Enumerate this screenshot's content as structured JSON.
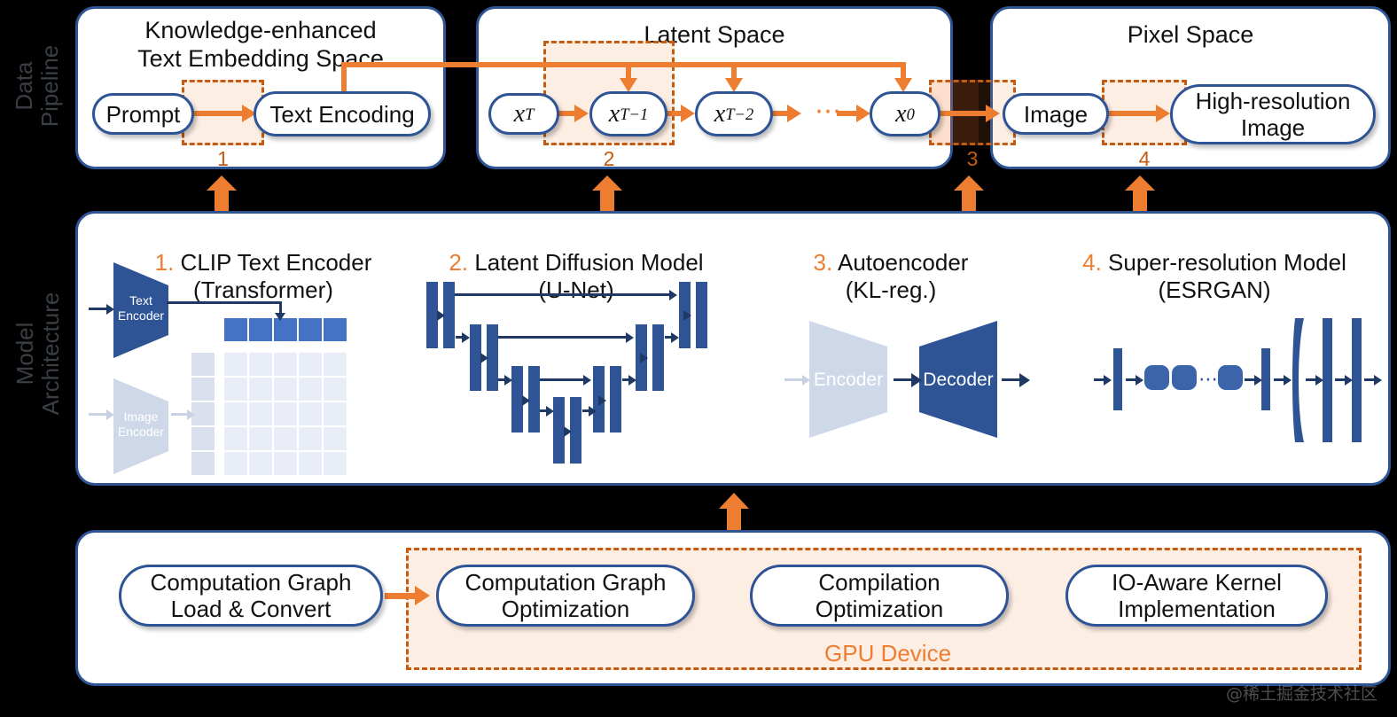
{
  "side_labels": [
    {
      "id": "data-pipeline",
      "text": "Data\nPipeline"
    },
    {
      "id": "model-architecture",
      "text": "Model\nArchitecture"
    }
  ],
  "data_pipeline": {
    "panels": [
      {
        "id": "text-embedding-space",
        "title": "Knowledge-enhanced\nText Embedding Space"
      },
      {
        "id": "latent-space",
        "title": "Latent Space"
      },
      {
        "id": "pixel-space",
        "title": "Pixel Space"
      }
    ],
    "nodes": [
      {
        "id": "prompt",
        "label": "Prompt"
      },
      {
        "id": "text-encoding",
        "label": "Text Encoding"
      },
      {
        "id": "x-T",
        "label": "x",
        "sub": "T"
      },
      {
        "id": "x-T-1",
        "label": "x",
        "sub": "T−1"
      },
      {
        "id": "x-T-2",
        "label": "x",
        "sub": "T−2"
      },
      {
        "id": "x-0",
        "label": "x",
        "sub": "0"
      },
      {
        "id": "image",
        "label": "Image"
      },
      {
        "id": "high-resolution-image",
        "label": "High-resolution\nImage"
      }
    ],
    "ellipsis": "⋯",
    "step_numbers": [
      "1",
      "2",
      "3",
      "4"
    ]
  },
  "model_architecture": {
    "blocks": [
      {
        "num": "1.",
        "title": " CLIP Text Encoder",
        "subtitle": "(Transformer)"
      },
      {
        "num": "2.",
        "title": " Latent Diffusion Model",
        "subtitle": "(U-Net)"
      },
      {
        "num": "3.",
        "title": " Autoencoder",
        "subtitle": "(KL-reg.)"
      },
      {
        "num": "4.",
        "title": " Super-resolution Model",
        "subtitle": "(ESRGAN)"
      }
    ],
    "clip": {
      "text_encoder": "Text\nEncoder",
      "image_encoder": "Image\nEncoder"
    },
    "autoencoder": {
      "encoder": "Encoder",
      "decoder": "Decoder"
    },
    "esrgan": {
      "ellipsis": "⋯"
    }
  },
  "runtime": {
    "nodes": [
      {
        "id": "computation-graph-load-convert",
        "label": "Computation Graph\nLoad & Convert"
      },
      {
        "id": "computation-graph-optimization",
        "label": "Computation Graph\nOptimization"
      },
      {
        "id": "compilation-optimization",
        "label": "Compilation\nOptimization"
      },
      {
        "id": "io-aware-kernel-implementation",
        "label": "IO-Aware Kernel\nImplementation"
      }
    ],
    "gpu_label": "GPU Device"
  },
  "watermark": "@稀土掘金技术社区",
  "colors": {
    "accent_orange": "#ed7d31",
    "dash_orange": "#c55a11",
    "panel_blue": "#2e5496",
    "block_blue": "#3b64ab",
    "light_blue": "#dde3ef"
  }
}
